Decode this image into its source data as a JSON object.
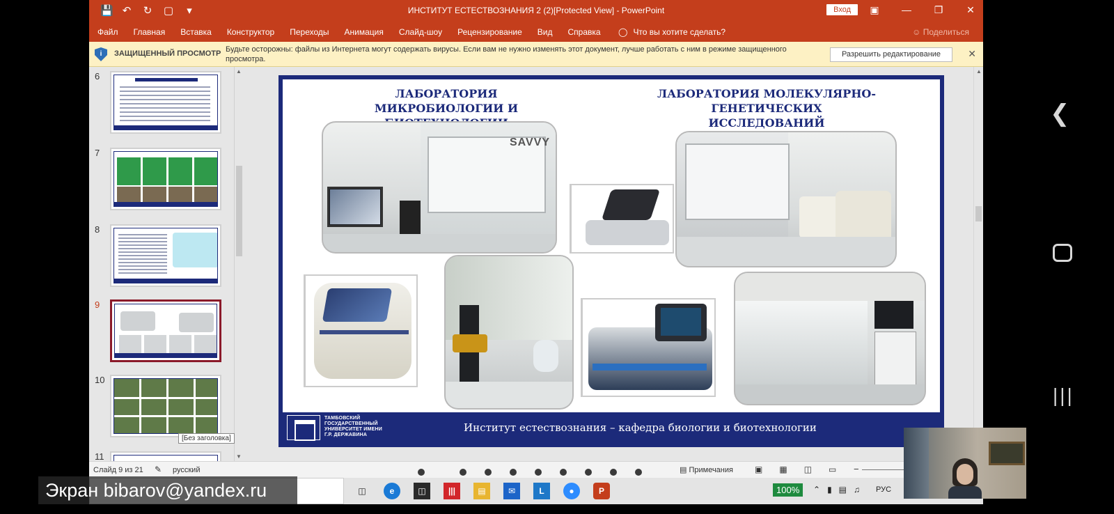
{
  "window": {
    "title": "ИНСТИТУТ ЕСТЕСТВОЗНАНИЯ 2 (2)[Protected View]  -  PowerPoint",
    "signin_label": "Вход"
  },
  "ribbon": {
    "tabs": [
      "Файл",
      "Главная",
      "Вставка",
      "Конструктор",
      "Переходы",
      "Анимация",
      "Слайд-шоу",
      "Рецензирование",
      "Вид",
      "Справка"
    ],
    "tell_me": "Что вы хотите сделать?",
    "share": "Поделиться"
  },
  "protected_view": {
    "title": "ЗАЩИЩЕННЫЙ ПРОСМОТР",
    "message": "Будьте осторожны: файлы из Интернета могут содержать вирусы. Если вам не нужно изменять этот документ, лучше работать с ним в режиме защищенного просмотра.",
    "enable_button": "Разрешить редактирование"
  },
  "thumbnails": [
    {
      "num": "6",
      "active": false
    },
    {
      "num": "7",
      "active": false
    },
    {
      "num": "8",
      "active": false
    },
    {
      "num": "9",
      "active": true
    },
    {
      "num": "10",
      "active": false
    },
    {
      "num": "11",
      "active": false
    }
  ],
  "tooltip": "[Без заголовка]",
  "slide": {
    "heading_left": "ЛАБОРАТОРИЯ МИКРОБИОЛОГИИ И БИОТЕХНОЛОГИИ",
    "heading_right": "ЛАБОРАТОРИЯ МОЛЕКУЛЯРНО-ГЕНЕТИЧЕСКИХ ИССЛЕДОВАНИЙ",
    "device_label": "SAVVY",
    "university": "ТАМБОВСКИЙ ГОСУДАРСТВЕННЫЙ УНИВЕРСИТЕТ ИМЕНИ Г.Р. ДЕРЖАВИНА",
    "footer_text": "Институт естествознания – кафедра биологии и биотехнологии"
  },
  "status": {
    "slide_info": "Слайд 9 из 21",
    "language": "русский",
    "notes": "Примечания"
  },
  "taskbar": {
    "zoom": "100%",
    "lang": "РУС"
  },
  "overlay": {
    "screen_label": "Экран bibarov@yandex.ru"
  },
  "colors": {
    "accent": "#c43e1c",
    "slide_navy": "#1c2a7a",
    "active_thumb": "#8b1a2a"
  }
}
